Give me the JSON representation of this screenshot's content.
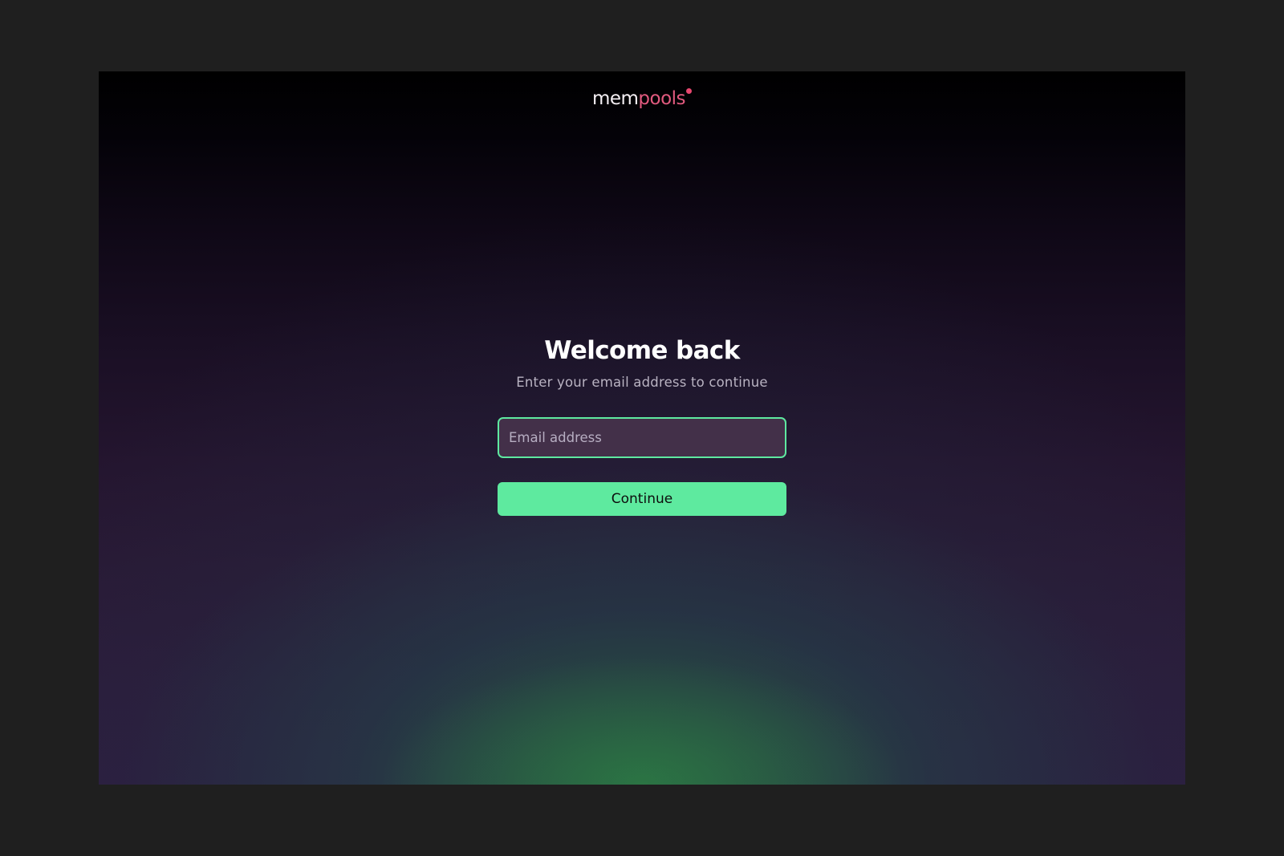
{
  "brand": {
    "name_part1": "mem",
    "name_part2": "pools"
  },
  "login": {
    "title": "Welcome back",
    "subtitle": "Enter your email address to continue",
    "email_placeholder": "Email address",
    "email_value": "",
    "continue_label": "Continue"
  },
  "colors": {
    "accent": "#5eea9f",
    "brand_pink": "#e25a7f",
    "page_outer": "#1f1f1f"
  }
}
